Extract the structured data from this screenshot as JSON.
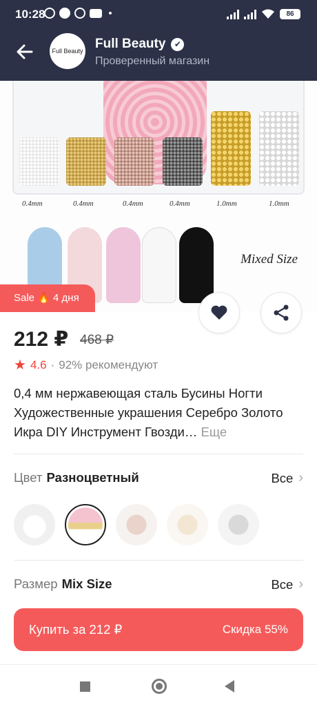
{
  "status_bar": {
    "time": "10:28",
    "battery": "86",
    "left_icons": [
      "alarm-icon",
      "chat-icon",
      "whatsapp-icon",
      "youtube-icon",
      "dot-icon"
    ],
    "right_icons": [
      "signal-icon",
      "signal-icon",
      "wifi-icon",
      "battery-icon"
    ]
  },
  "header": {
    "back_icon": "arrow-left-icon",
    "logo_text": "Full Beauty",
    "shop_name": "Full Beauty",
    "verified_icon": "verified-check-icon",
    "shop_subtitle": "Проверенный магазин"
  },
  "product_image": {
    "sizes": [
      "0.4mm",
      "0.4mm",
      "0.4mm",
      "0.4mm",
      "1.0mm",
      "1.0mm"
    ],
    "mixed_label": "Mixed Size"
  },
  "sale_badge": {
    "text": "Sale 🔥 4 дня"
  },
  "actions": {
    "favorite_icon": "heart-icon",
    "share_icon": "share-icon"
  },
  "price": {
    "current": "212 ₽",
    "old": "468 ₽"
  },
  "rating": {
    "value": "4.6",
    "separator": "·",
    "recommend": "92% рекомендуют",
    "star_icon": "star-icon"
  },
  "description": {
    "text": "0,4 мм нержавеющая сталь Бусины Ногти Художественные украшения Серебро Золото Икра DIY Инструмент Гвозди…",
    "more": "Еще"
  },
  "color_option": {
    "label": "Цвет",
    "value": "Разноцветный",
    "all": "Все",
    "selected_index": 1
  },
  "size_option": {
    "label": "Размер",
    "value": "Mix Size",
    "all": "Все"
  },
  "buy_button": {
    "label": "Купить за 212 ₽",
    "discount": "Скидка 55%"
  },
  "colors": {
    "header_bg": "#2c3147",
    "accent": "#f55a5a",
    "rating": "#f0433a"
  }
}
